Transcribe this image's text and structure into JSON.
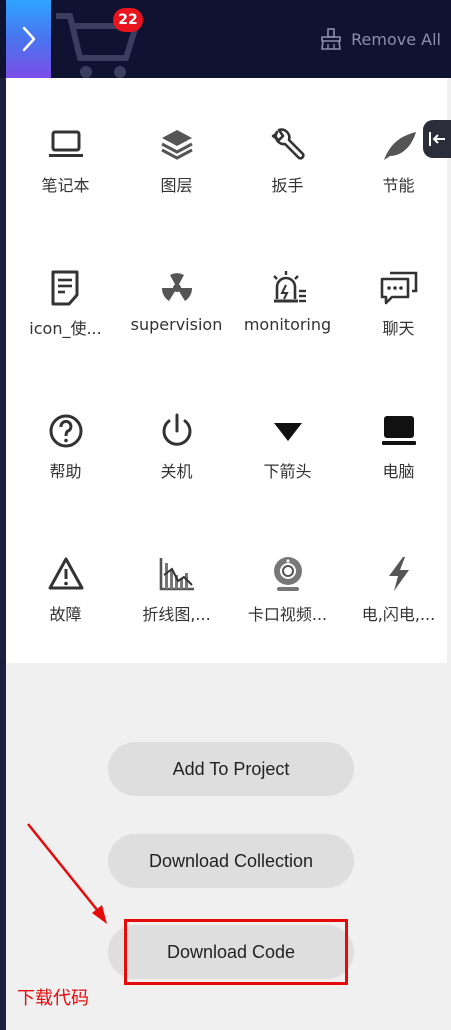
{
  "header": {
    "cart_count": "22",
    "remove_all_label": "Remove All"
  },
  "icons": [
    {
      "label": "笔记本",
      "icon": "laptop-icon"
    },
    {
      "label": "图层",
      "icon": "layers-icon"
    },
    {
      "label": "扳手",
      "icon": "wrench-icon"
    },
    {
      "label": "节能",
      "icon": "leaf-icon"
    },
    {
      "label": "icon_使...",
      "icon": "document-icon"
    },
    {
      "label": "supervision",
      "icon": "radiation-icon"
    },
    {
      "label": "monitoring",
      "icon": "alarm-light-icon"
    },
    {
      "label": "聊天",
      "icon": "chat-icon"
    },
    {
      "label": "帮助",
      "icon": "help-icon"
    },
    {
      "label": "关机",
      "icon": "power-icon"
    },
    {
      "label": "下箭头",
      "icon": "down-arrow-icon"
    },
    {
      "label": "电脑",
      "icon": "computer-icon"
    },
    {
      "label": "故障",
      "icon": "warning-icon"
    },
    {
      "label": "折线图,...",
      "icon": "line-chart-icon"
    },
    {
      "label": "卡口视频...",
      "icon": "camera-icon"
    },
    {
      "label": "电,闪电,...",
      "icon": "lightning-icon"
    }
  ],
  "actions": {
    "add_to_project": "Add To Project",
    "download_collection": "Download Collection",
    "download_code": "Download Code"
  },
  "annotation": "下载代码",
  "colors": {
    "header_bg": "#0f1230",
    "badge": "#e8141e",
    "annotation_red": "#e50b0b",
    "button_bg": "#dedede"
  }
}
